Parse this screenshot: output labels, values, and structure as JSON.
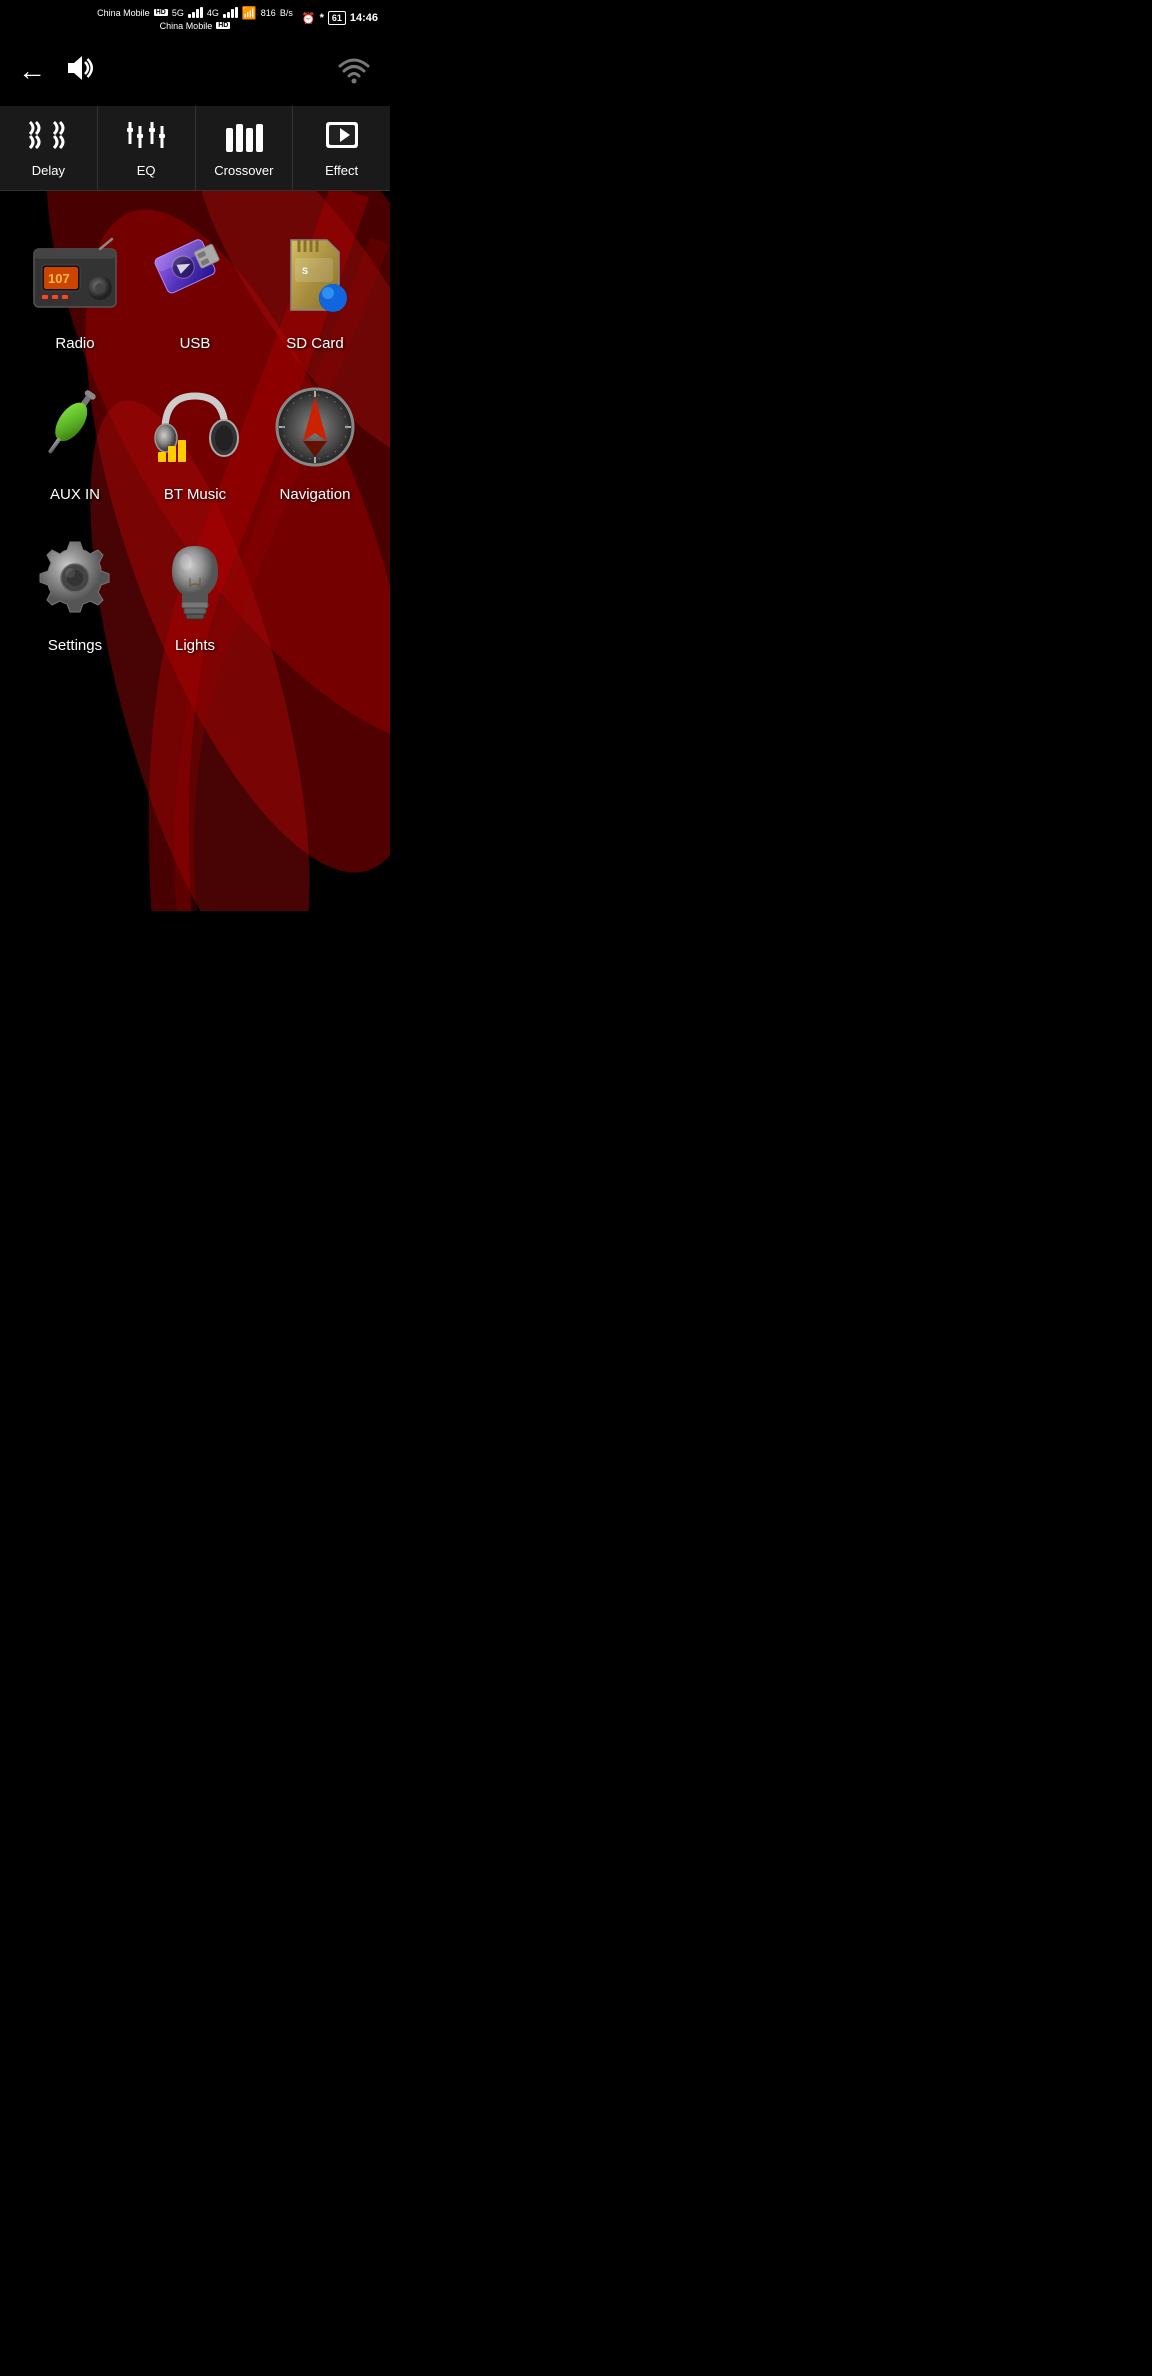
{
  "statusBar": {
    "carrier1": "China Mobile",
    "carrier2": "China Mobile",
    "badge1": "HD",
    "badge2": "5G",
    "badge3": "4G",
    "badge4": "HD",
    "speed": "816",
    "speedUnit": "B/s",
    "time": "14:46",
    "battery": "61"
  },
  "topBar": {
    "backLabel": "←",
    "volumeLabel": "🔊"
  },
  "tabs": [
    {
      "id": "delay",
      "label": "Delay",
      "icon": "delay"
    },
    {
      "id": "eq",
      "label": "EQ",
      "icon": "eq"
    },
    {
      "id": "crossover",
      "label": "Crossover",
      "icon": "crossover"
    },
    {
      "id": "effect",
      "label": "Effect",
      "icon": "effect"
    }
  ],
  "apps": [
    {
      "id": "radio",
      "label": "Radio",
      "icon": "radio"
    },
    {
      "id": "usb",
      "label": "USB",
      "icon": "usb"
    },
    {
      "id": "sdcard",
      "label": "SD Card",
      "icon": "sdcard"
    },
    {
      "id": "auxin",
      "label": "AUX IN",
      "icon": "auxin"
    },
    {
      "id": "btmusic",
      "label": "BT Music",
      "icon": "btmusic"
    },
    {
      "id": "navigation",
      "label": "Navigation",
      "icon": "navigation"
    },
    {
      "id": "settings",
      "label": "Settings",
      "icon": "settings"
    },
    {
      "id": "lights",
      "label": "Lights",
      "icon": "lights"
    }
  ]
}
